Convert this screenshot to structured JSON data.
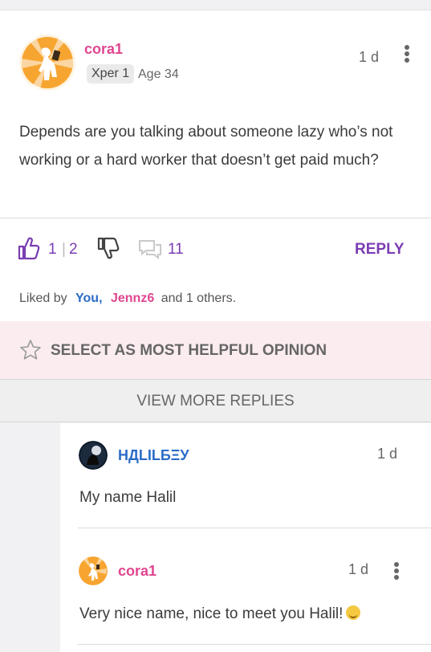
{
  "post": {
    "username": "cora1",
    "xper_badge": "Xper 1",
    "age": "Age 34",
    "time": "1 d",
    "text": "Depends are you talking about someone lazy who’s not working or a hard worker that doesn’t get paid much?"
  },
  "actions": {
    "like_count": "1",
    "divider": "|",
    "like_count_2": "2",
    "comment_count": "11",
    "reply_label": "REPLY"
  },
  "liked_by": {
    "prefix": "Liked by",
    "you": "You,",
    "user": "Jennz6",
    "suffix": "and 1 others."
  },
  "helpful": {
    "label": "SELECT AS MOST HELPFUL OPINION"
  },
  "view_more": {
    "label": "VIEW MORE REPLIES"
  },
  "replies": [
    {
      "username": "НДLILБΞУ",
      "time": "1 d",
      "text": "My name Halil"
    },
    {
      "username": "cora1",
      "time": "1 d",
      "text": "Very nice name, nice to meet you Halil!"
    }
  ],
  "colors": {
    "username_pink": "#e0458f",
    "username_blue": "#2a6cc7",
    "accent_purple": "#7a3db3",
    "helpful_bg": "#fbecef"
  },
  "icons": [
    "kebab-menu-icon",
    "thumbs-up-icon",
    "thumbs-down-icon",
    "comment-icon",
    "star-icon",
    "smiling-emoji-icon"
  ]
}
